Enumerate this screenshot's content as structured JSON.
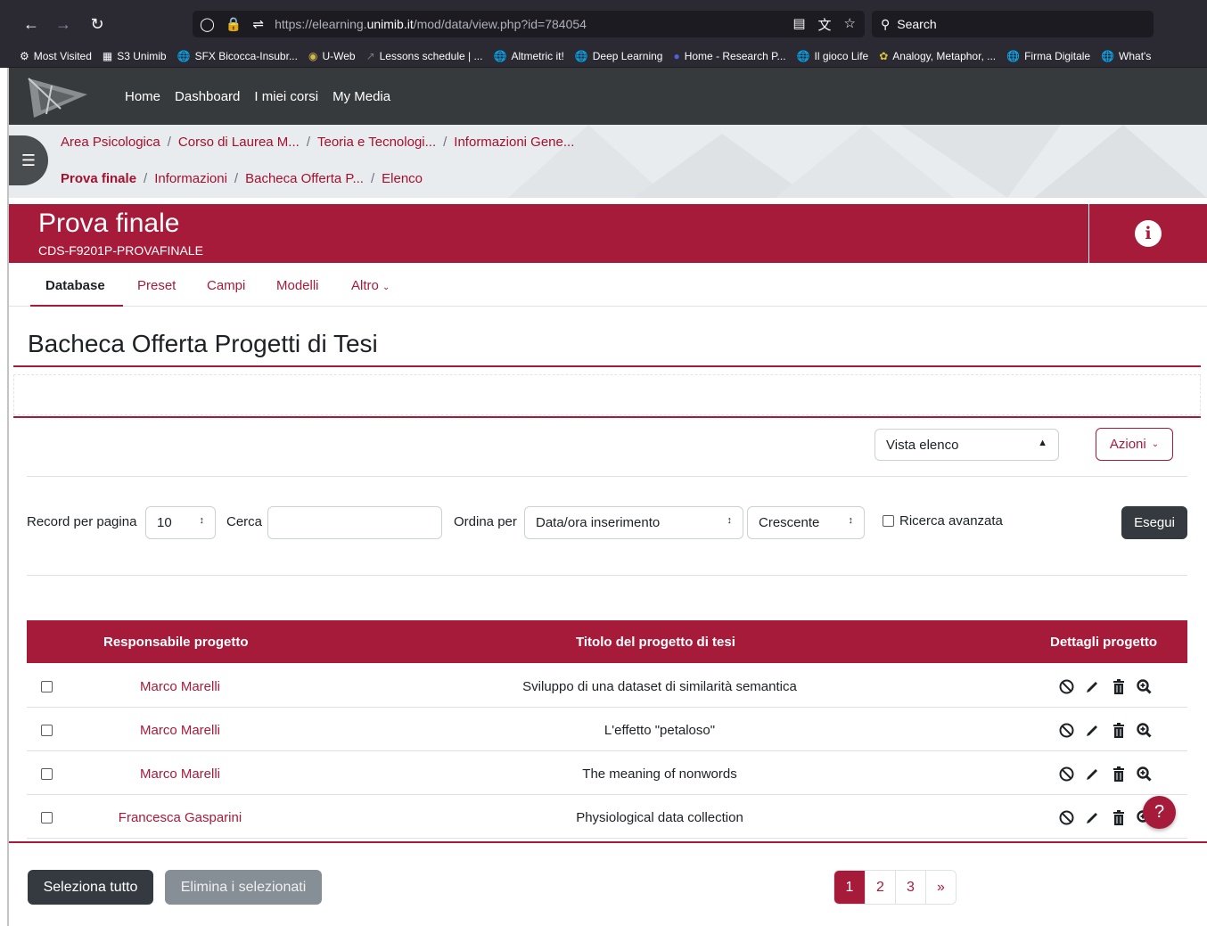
{
  "browser": {
    "url_prefix": "https://elearning.",
    "url_domain": "unimib.it",
    "url_path": "/mod/data/view.php?id=784054",
    "search_placeholder": "Search",
    "bookmarks": [
      {
        "icon": "gear-icon",
        "label": "Most Visited"
      },
      {
        "icon": "s3-favicon",
        "label": "S3 Unimib"
      },
      {
        "icon": "globe-icon",
        "label": "SFX Bicocca-Insubr..."
      },
      {
        "icon": "uweb-favicon",
        "label": "U-Web"
      },
      {
        "icon": "arrow-favicon",
        "label": "Lessons schedule | ..."
      },
      {
        "icon": "globe-icon",
        "label": "Altmetric it!"
      },
      {
        "icon": "globe-icon",
        "label": "Deep Learning"
      },
      {
        "icon": "eu-favicon",
        "label": "Home - Research P..."
      },
      {
        "icon": "globe-icon",
        "label": "Il gioco Life"
      },
      {
        "icon": "feather-favicon",
        "label": "Analogy, Metaphor, ..."
      },
      {
        "icon": "globe-icon",
        "label": "Firma Digitale"
      },
      {
        "icon": "globe-icon",
        "label": "What's"
      }
    ]
  },
  "navbar": {
    "links": [
      "Home",
      "Dashboard",
      "I miei corsi",
      "My Media"
    ]
  },
  "breadcrumb": {
    "row1": [
      "Area Psicologica",
      "Corso di Laurea M...",
      "Teoria e Tecnologi...",
      "Informazioni Gene..."
    ],
    "row2": [
      "Prova finale",
      "Informazioni",
      "Bacheca Offerta P...",
      "Elenco"
    ]
  },
  "course": {
    "title": "Prova finale",
    "code": "CDS-F9201P-PROVAFINALE",
    "info_glyph": "i"
  },
  "tabs": {
    "items": [
      "Database",
      "Preset",
      "Campi",
      "Modelli",
      "Altro"
    ],
    "active": "Database"
  },
  "page": {
    "heading": "Bacheca Offerta Progetti di Tesi"
  },
  "view": {
    "view_select": "Vista elenco",
    "actions_label": "Azioni"
  },
  "filters": {
    "per_page_label": "Record per pagina",
    "per_page_value": "10",
    "search_label": "Cerca",
    "search_value": "",
    "sort_label": "Ordina per",
    "sort_value": "Data/ora inserimento",
    "order_value": "Crescente",
    "advanced_label": "Ricerca avanzata",
    "advanced_checked": false,
    "submit_label": "Esegui"
  },
  "table": {
    "headers": [
      "Responsabile progetto",
      "Titolo del progetto di tesi",
      "Dettagli progetto"
    ],
    "rows": [
      {
        "responsabile": "Marco Marelli",
        "titolo": "Sviluppo di una dataset di similarità semantica"
      },
      {
        "responsabile": "Marco Marelli",
        "titolo": "L'effetto \"petaloso\""
      },
      {
        "responsabile": "Marco Marelli",
        "titolo": "The meaning of nonwords"
      },
      {
        "responsabile": "Francesca Gasparini",
        "titolo": "Physiological data collection"
      }
    ],
    "row_actions": [
      "approve-off-icon",
      "pencil-icon",
      "trash-icon",
      "zoom-icon"
    ]
  },
  "footer": {
    "select_all": "Seleziona tutto",
    "delete_selected": "Elimina i selezionati",
    "pages": [
      "1",
      "2",
      "3",
      "»"
    ],
    "current_page": "1",
    "help_glyph": "?"
  },
  "colors": {
    "brand": "#a71b3a",
    "navbar": "#373a3c",
    "browser_chrome": "#2b2a33"
  }
}
